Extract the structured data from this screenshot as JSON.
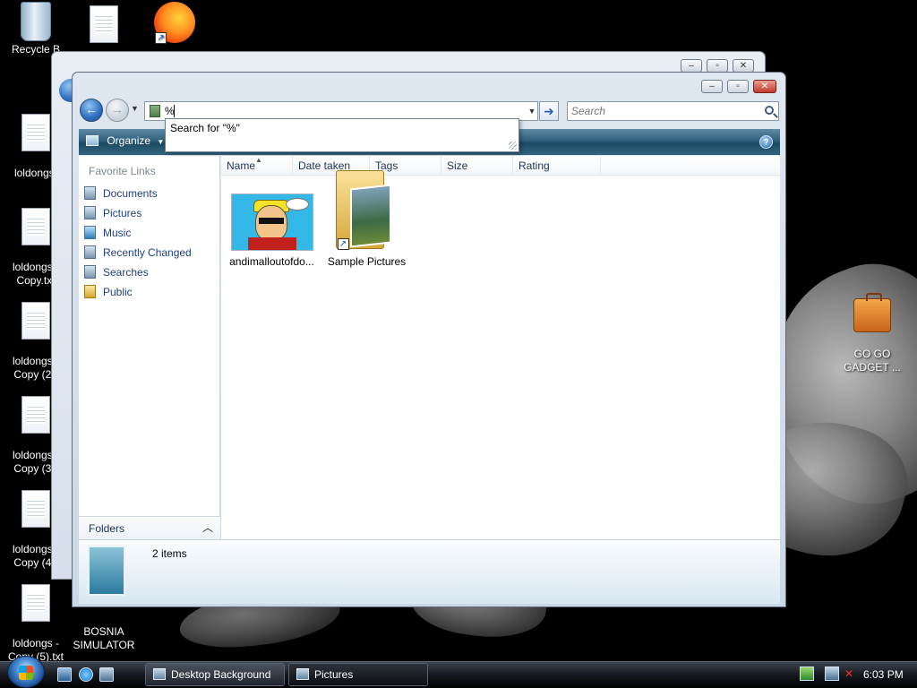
{
  "desktop": {
    "icons": [
      {
        "label": "Recycle B"
      },
      {
        "label": ""
      },
      {
        "label": ""
      },
      {
        "label": "loldongs."
      },
      {
        "label": "loldongs -\nCopy.txt"
      },
      {
        "label": "loldongs -\nCopy (2)."
      },
      {
        "label": "loldongs -\nCopy (3)."
      },
      {
        "label": "loldongs -\nCopy (4)."
      },
      {
        "label": "loldongs -\nCopy (5).txt"
      },
      {
        "label": "BOSNIA\nSIMULATOR"
      },
      {
        "label": "GO GO\nGADGET ..."
      }
    ]
  },
  "window": {
    "address_value": "%",
    "search_placeholder": "Search",
    "suggestion": "Search for \"%\"",
    "toolbar": {
      "organize_label": "Organize",
      "help_label": "?"
    },
    "favorites": {
      "heading": "Favorite Links",
      "items": [
        {
          "label": "Documents"
        },
        {
          "label": "Pictures"
        },
        {
          "label": "Music"
        },
        {
          "label": "Recently Changed"
        },
        {
          "label": "Searches"
        },
        {
          "label": "Public"
        }
      ]
    },
    "folders_label": "Folders",
    "columns": [
      "Name",
      "Date taken",
      "Tags",
      "Size",
      "Rating"
    ],
    "items": [
      {
        "label": "andimalloutofdo..."
      },
      {
        "label": "Sample Pictures"
      }
    ],
    "status_count": "2 items"
  },
  "taskbar": {
    "buttons": [
      {
        "label": "Desktop Background"
      },
      {
        "label": "Pictures"
      }
    ],
    "clock": "6:03 PM"
  }
}
